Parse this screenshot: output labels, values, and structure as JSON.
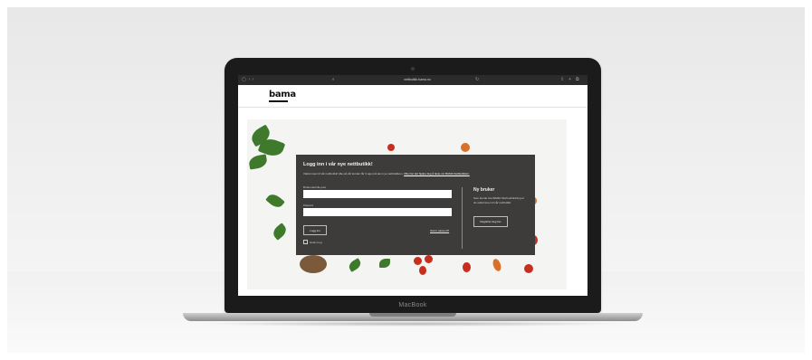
{
  "device": {
    "brand_label": "MacBook"
  },
  "browser": {
    "url": "nettbutikk.bama.no"
  },
  "site": {
    "logo_text": "bama"
  },
  "login": {
    "title": "Logg inn i vår nye nettbutikk!",
    "description_prefix": "Velkommen til vår nettbutikk! Alle på vår kunder får 3 uger på den nye nettbutikken.",
    "description_link": "Ofte har det hjelpe deg å laste om BAMA Nettbutikken.",
    "username_label": "Brukernavn/E-post",
    "username_value": "",
    "password_label": "Passord",
    "password_value": "",
    "login_button": "Logg inn",
    "forgot_link": "Glemt passord?",
    "remember_label": "Husk meg"
  },
  "new_user": {
    "title": "Ny bruker",
    "description": "Som kunde hos BAMA Storhusholdning er du velkommen til vår nettbutikk",
    "register_button": "Registrer deg her"
  },
  "colors": {
    "panel_bg": "#3d3c3a",
    "laptop_lid": "#1b1b1b"
  }
}
